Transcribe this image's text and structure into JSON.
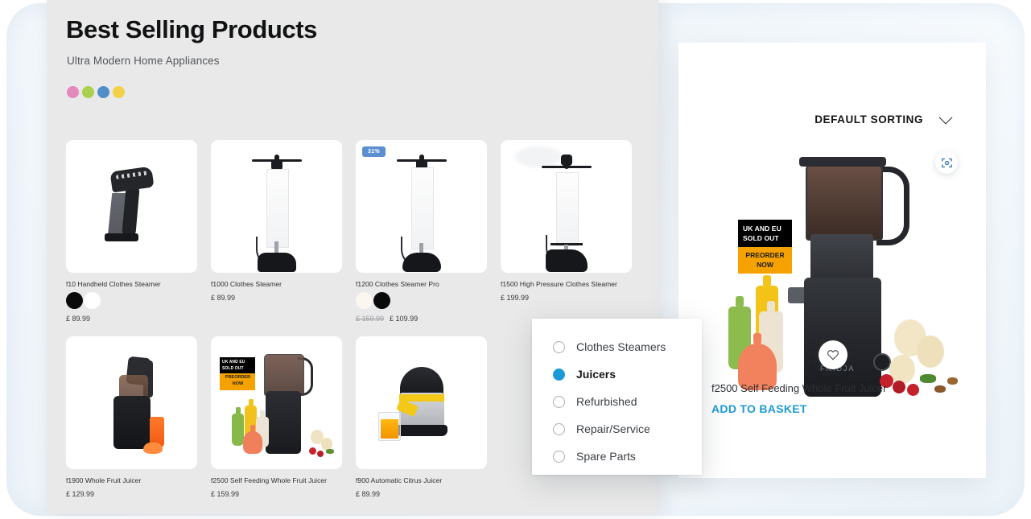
{
  "header": {
    "title": "Best Selling Products",
    "subtitle": "Ultra Modern Home Appliances",
    "dots": [
      "#e489bb",
      "#a9d04e",
      "#528dc8",
      "#f2d049"
    ]
  },
  "products": [
    {
      "name": "f10 Handheld Clothes Steamer",
      "price": "£ 89.99",
      "old_price": "",
      "badge": "",
      "swatches": [
        "black",
        "white"
      ],
      "art": "handheld-steamer"
    },
    {
      "name": "f1000 Clothes Steamer",
      "price": "£ 89.99",
      "old_price": "",
      "badge": "",
      "swatches": [],
      "art": "upright-steamer"
    },
    {
      "name": "f1200 Clothes Steamer Pro",
      "price": "£ 109.99",
      "old_price": "£ 159.99",
      "badge": "31%",
      "swatches": [
        "cream",
        "black"
      ],
      "art": "upright-steamer-pro"
    },
    {
      "name": "f1500 High Pressure Clothes Steamer",
      "price": "£ 199.99",
      "old_price": "",
      "badge": "",
      "swatches": [],
      "art": "pressure-steamer"
    },
    {
      "name": "f1900 Whole Fruit Juicer",
      "price": "£ 129.99",
      "old_price": "",
      "badge": "",
      "swatches": [],
      "art": "tall-juicer"
    },
    {
      "name": "f2500 Self Feeding Whole Fruit Juicer",
      "price": "£ 159.99",
      "old_price": "",
      "badge": "",
      "badge_sold": "UK AND EU SOLD OUT",
      "badge_preorder": "PREORDER NOW",
      "swatches": [],
      "art": "jar-juicer"
    },
    {
      "name": "f900 Automatic Citrus Juicer",
      "price": "£ 89.99",
      "old_price": "",
      "badge": "",
      "swatches": [],
      "art": "citrus-juicer"
    }
  ],
  "filter": {
    "items": [
      {
        "label": "Clothes Steamers",
        "selected": false
      },
      {
        "label": "Juicers",
        "selected": true
      },
      {
        "label": "Refurbished",
        "selected": false
      },
      {
        "label": "Repair/Service",
        "selected": false
      },
      {
        "label": "Spare Parts",
        "selected": false
      }
    ],
    "accent": "#1a9ad6"
  },
  "detail": {
    "sorting_label": "DEFAULT SORTING",
    "badge_sold_out": "UK AND EU SOLD OUT",
    "badge_preorder": "PREORDER NOW",
    "brand_mark": "FRIDJA",
    "product_name": "f2500 Self Feeding Whole Fruit Juicer",
    "add_to_basket": "ADD TO BASKET",
    "accent": "#1a9ad6"
  }
}
